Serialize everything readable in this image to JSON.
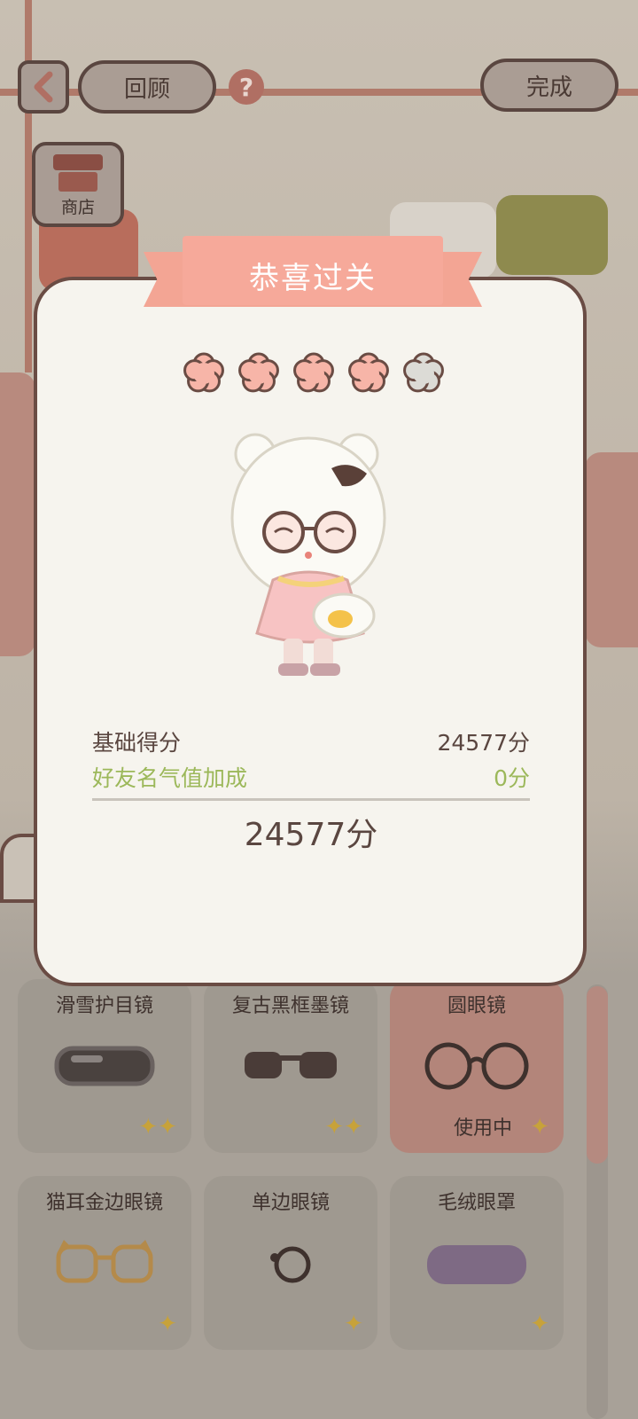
{
  "header": {
    "review_label": "回顾",
    "done_label": "完成",
    "help_glyph": "?",
    "shop_label": "商店"
  },
  "modal": {
    "title": "恭喜过关",
    "stars_filled": 4,
    "stars_total": 5,
    "star_colors": {
      "filled": "#f7b5a8",
      "empty": "#dcdbd6",
      "outline": "#6a4c44"
    },
    "base_score_label": "基础得分",
    "base_score_value": "24577分",
    "bonus_label": "好友名气值加成",
    "bonus_value": "0分",
    "total_score": "24577分",
    "colors": {
      "bonus": "#9cb85a",
      "text": "#5a4640"
    }
  },
  "items": [
    {
      "name": "滑雪护目镜",
      "icon": "ski-goggles-icon",
      "active": false
    },
    {
      "name": "复古黑框墨镜",
      "icon": "black-sunglasses-icon",
      "active": false
    },
    {
      "name": "圆眼镜",
      "icon": "round-glasses-icon",
      "active": true,
      "status": "使用中"
    },
    {
      "name": "猫耳金边眼镜",
      "icon": "cat-ear-glasses-icon",
      "active": false
    },
    {
      "name": "单边眼镜",
      "icon": "monocle-icon",
      "active": false
    },
    {
      "name": "毛绒眼罩",
      "icon": "plush-eye-mask-icon",
      "active": false
    }
  ]
}
